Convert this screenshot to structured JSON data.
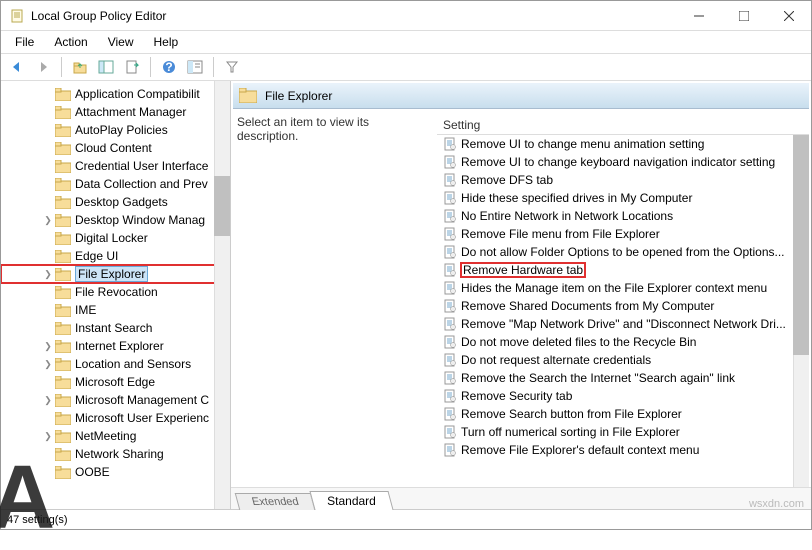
{
  "window": {
    "title": "Local Group Policy Editor"
  },
  "menubar": [
    "File",
    "Action",
    "View",
    "Help"
  ],
  "path_header": "File Explorer",
  "description_prompt": "Select an item to view its description.",
  "settings_header": "Setting",
  "tree": [
    {
      "label": "Application Compatibilit",
      "expandable": false
    },
    {
      "label": "Attachment Manager",
      "expandable": false
    },
    {
      "label": "AutoPlay Policies",
      "expandable": false
    },
    {
      "label": "Cloud Content",
      "expandable": false
    },
    {
      "label": "Credential User Interface",
      "expandable": false
    },
    {
      "label": "Data Collection and Prev",
      "expandable": false
    },
    {
      "label": "Desktop Gadgets",
      "expandable": false
    },
    {
      "label": "Desktop Window Manag",
      "expandable": true
    },
    {
      "label": "Digital Locker",
      "expandable": false
    },
    {
      "label": "Edge UI",
      "expandable": false
    },
    {
      "label": "File Explorer",
      "expandable": true,
      "selected": true,
      "highlighted": true
    },
    {
      "label": "File Revocation",
      "expandable": false
    },
    {
      "label": "IME",
      "expandable": false
    },
    {
      "label": "Instant Search",
      "expandable": false
    },
    {
      "label": "Internet Explorer",
      "expandable": true
    },
    {
      "label": "Location and Sensors",
      "expandable": true
    },
    {
      "label": "Microsoft Edge",
      "expandable": false
    },
    {
      "label": "Microsoft Management C",
      "expandable": true
    },
    {
      "label": "Microsoft User Experienc",
      "expandable": false
    },
    {
      "label": "NetMeeting",
      "expandable": true
    },
    {
      "label": "Network Sharing",
      "expandable": false
    },
    {
      "label": "OOBE",
      "expandable": false
    }
  ],
  "settings": [
    {
      "label": "Remove UI to change menu animation setting"
    },
    {
      "label": "Remove UI to change keyboard navigation indicator setting"
    },
    {
      "label": "Remove DFS tab"
    },
    {
      "label": "Hide these specified drives in My Computer"
    },
    {
      "label": "No Entire Network in Network Locations"
    },
    {
      "label": "Remove File menu from File Explorer"
    },
    {
      "label": "Do not allow Folder Options to be opened from the Options..."
    },
    {
      "label": "Remove Hardware tab",
      "highlighted": true
    },
    {
      "label": "Hides the Manage item on the File Explorer context menu"
    },
    {
      "label": "Remove Shared Documents from My Computer"
    },
    {
      "label": "Remove \"Map Network Drive\" and \"Disconnect Network Dri..."
    },
    {
      "label": "Do not move deleted files to the Recycle Bin"
    },
    {
      "label": "Do not request alternate credentials"
    },
    {
      "label": "Remove the Search the Internet \"Search again\" link"
    },
    {
      "label": "Remove Security tab"
    },
    {
      "label": "Remove Search button from File Explorer"
    },
    {
      "label": "Turn off numerical sorting in File Explorer"
    },
    {
      "label": "Remove File Explorer's default context menu"
    }
  ],
  "tabs": {
    "extended": "Extended",
    "standard": "Standard"
  },
  "status": "47 setting(s)",
  "watermark": "wsxdn.com"
}
